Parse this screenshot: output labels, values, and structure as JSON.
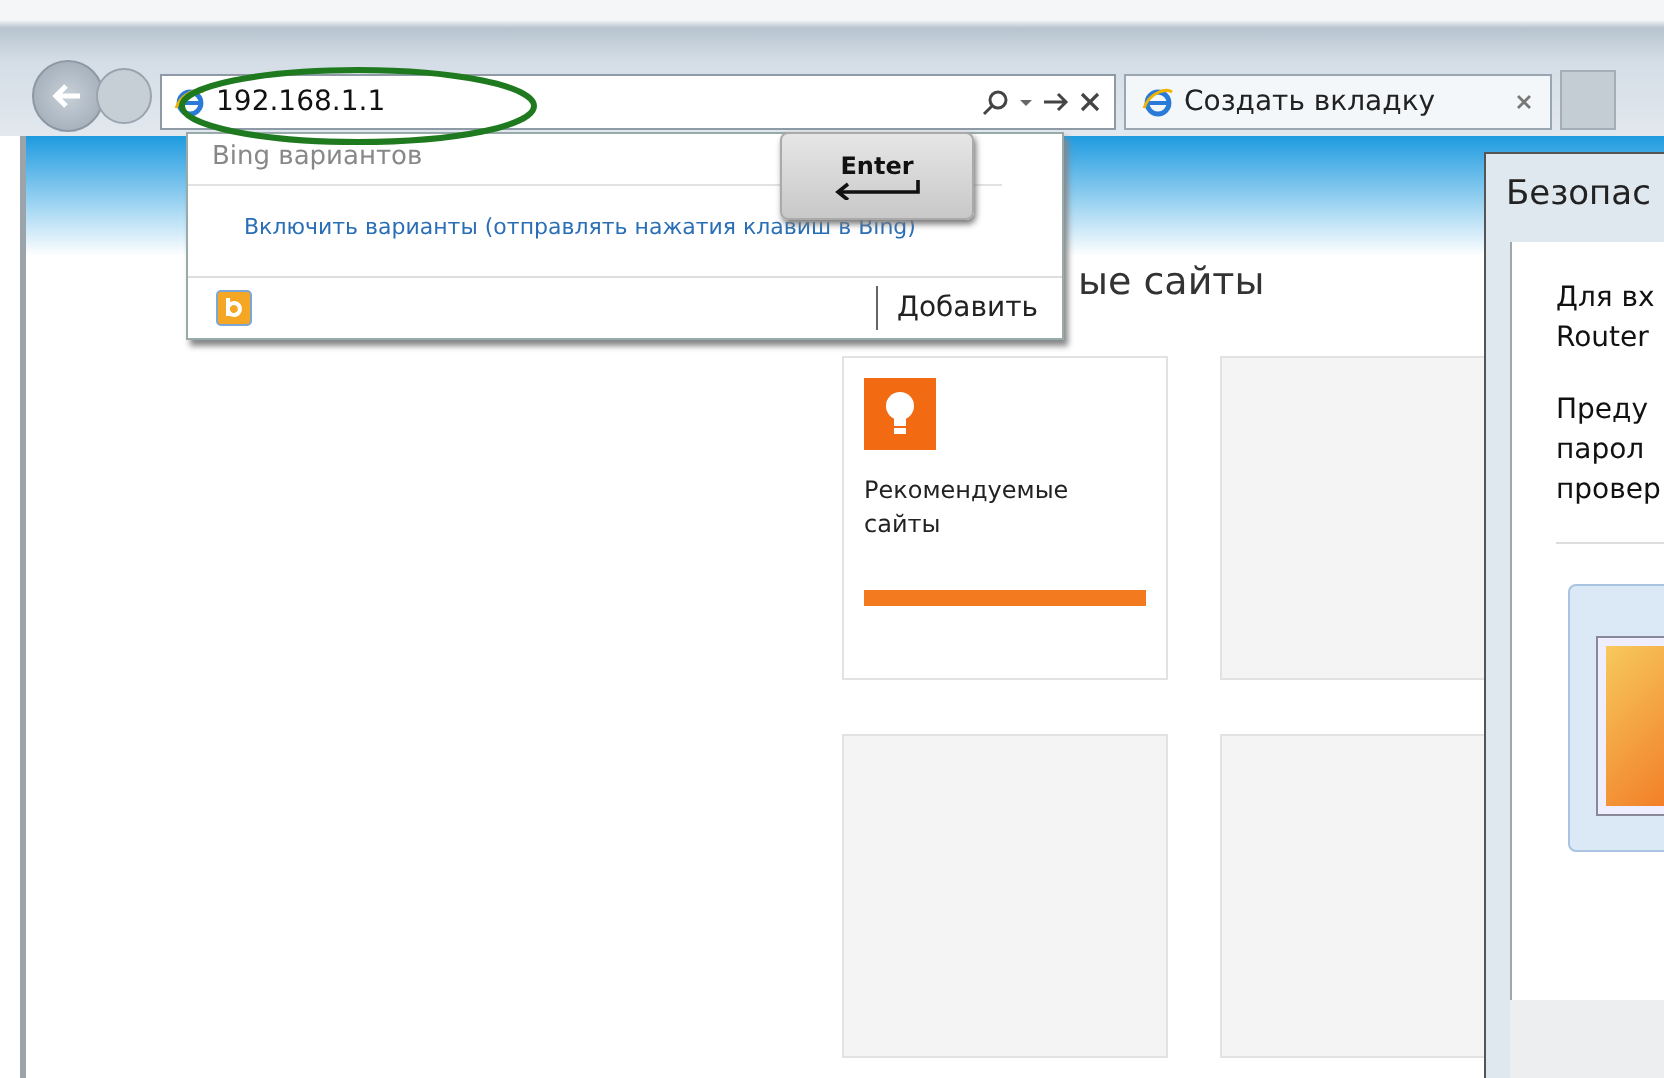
{
  "address_bar": {
    "value": "192.168.1.1"
  },
  "tab": {
    "title": "Создать вкладку"
  },
  "suggestions": {
    "header": "Bing вариантов",
    "link": "Включить варианты (отправлять нажатия клавиш в Bing)",
    "add_button": "Добавить"
  },
  "enter_key": {
    "label": "Enter"
  },
  "page": {
    "heading": "ые сайты",
    "tiles": [
      {
        "kind": "featured",
        "label": "Рекомендуемые сайты"
      },
      {
        "kind": "empty"
      },
      {
        "kind": "empty"
      },
      {
        "kind": "empty"
      }
    ]
  },
  "dialog": {
    "title": "Безопас",
    "paragraphs": [
      [
        "Для вх",
        "Router"
      ],
      [
        "Преду",
        "парол",
        "провер"
      ]
    ]
  }
}
